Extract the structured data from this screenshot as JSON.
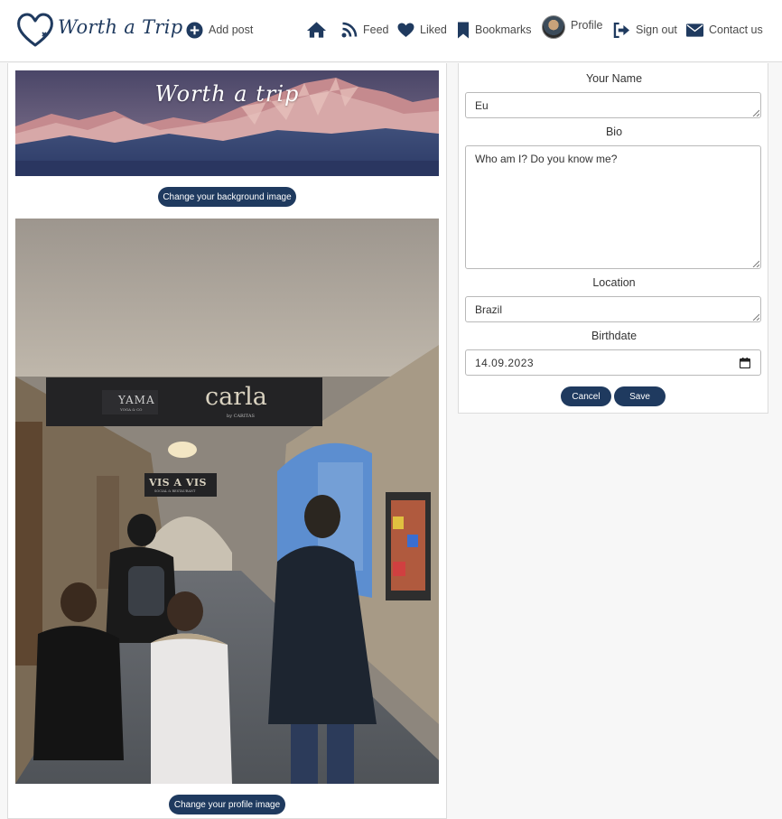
{
  "nav": {
    "brand": "Worth a Trip",
    "add_post": "Add post",
    "items": [
      {
        "label": "",
        "icon": "home-icon"
      },
      {
        "label": "Feed",
        "icon": "rss-icon"
      },
      {
        "label": "Liked",
        "icon": "heart-icon"
      },
      {
        "label": "Bookmarks",
        "icon": "bookmark-icon"
      },
      {
        "label": "Profile",
        "icon": "avatar"
      },
      {
        "label": "Sign out",
        "icon": "sign-out-icon"
      },
      {
        "label": "Contact us",
        "icon": "envelope-icon"
      }
    ]
  },
  "profile": {
    "banner_title": "Worth a trip",
    "change_background_label": "Change your background image",
    "change_profile_label": "Change your profile image",
    "photo_signs": {
      "left_sign": "YAMA",
      "left_sign_sub": "YOGA & CO",
      "right_sign": "carla",
      "right_sign_sub": "by CARITAS",
      "small_sign": "VIS A VIS",
      "small_sign_sub": "SOCIAL & RESTAURANT"
    }
  },
  "form": {
    "name_label": "Your Name",
    "name_value": "Eu",
    "bio_label": "Bio",
    "bio_value": "Who am I? Do you know me?",
    "location_label": "Location",
    "location_value": "Brazil",
    "birthdate_label": "Birthdate",
    "birthdate_value": "14.09.2023",
    "cancel_label": "Cancel",
    "save_label": "Save"
  },
  "colors": {
    "brand": "#1f3a5f",
    "navbar_bg": "#ffffff",
    "page_bg": "#f7f7f7"
  }
}
